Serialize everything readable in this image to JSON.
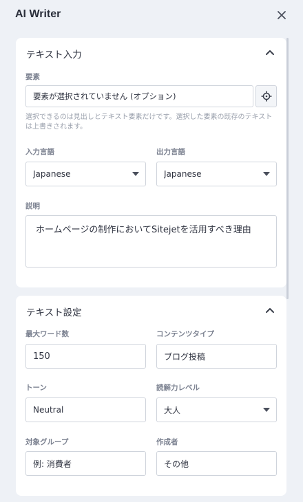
{
  "app": {
    "title": "AI Writer"
  },
  "text_input": {
    "title": "テキスト入力",
    "element_label": "要素",
    "element_value": "要素が選択されていません (オプション)",
    "element_hint": "選択できるのは見出しとテキスト要素だけです。選択した要素の既存のテキストは上書きされます。",
    "input_language_label": "入力言語",
    "input_language_value": "Japanese",
    "output_language_label": "出力言語",
    "output_language_value": "Japanese",
    "description_label": "説明",
    "description_value": "ホームページの制作においてSitejetを活用すべき理由"
  },
  "text_settings": {
    "title": "テキスト設定",
    "max_words_label": "最大ワード数",
    "max_words_value": "150",
    "content_type_label": "コンテンツタイプ",
    "content_type_value": "ブログ投稿",
    "tone_label": "トーン",
    "tone_value": "Neutral",
    "reading_level_label": "読解力レベル",
    "reading_level_value": "大人",
    "target_group_label": "対象グループ",
    "target_group_placeholder": "例: 消費者",
    "author_label": "作成者",
    "author_value": "その他"
  },
  "colors": {
    "background": "#eef1f6",
    "card": "#ffffff",
    "border": "#cfd4dc",
    "label": "#7b8190",
    "hint": "#9aa0ac"
  },
  "icons": [
    "close-icon",
    "chevron-up-icon",
    "crosshair-icon",
    "caret-down-icon"
  ]
}
